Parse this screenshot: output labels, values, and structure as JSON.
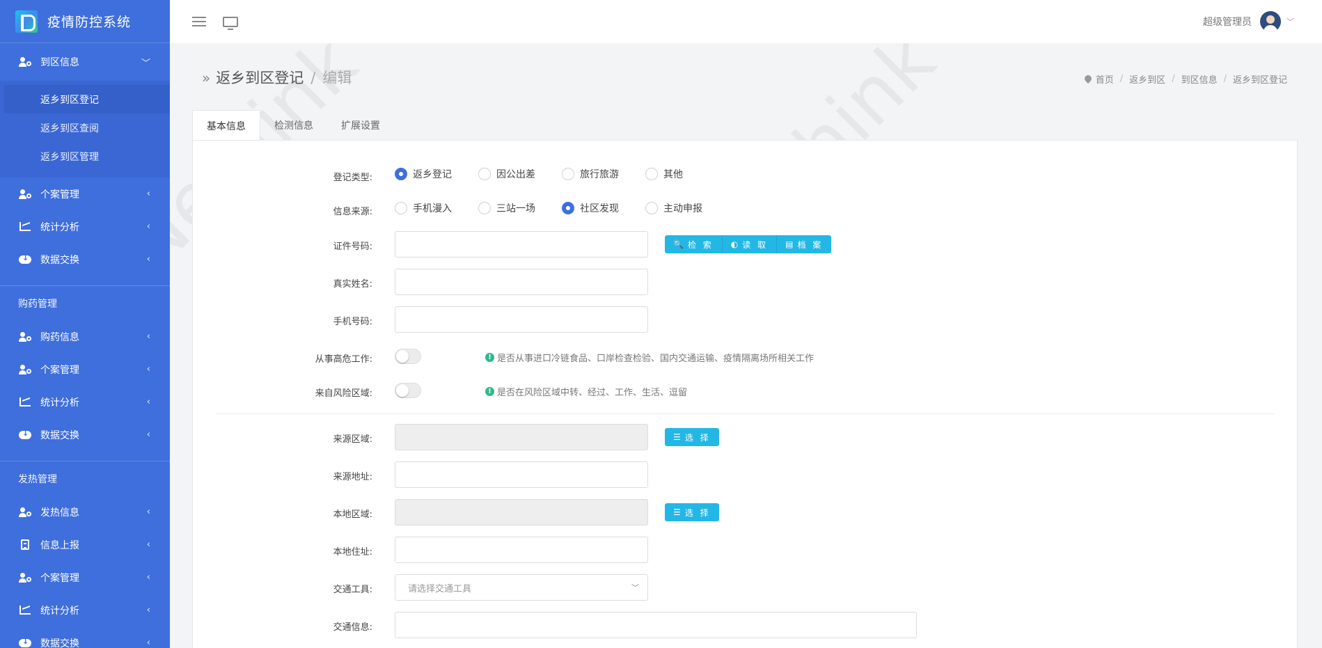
{
  "app": {
    "title": "疫情防控系统"
  },
  "topbar": {
    "admin_name": "超级管理员"
  },
  "sidebar": {
    "group1": {
      "open_item": "到区信息",
      "sub_items": [
        "返乡到区登记",
        "返乡到区查阅",
        "返乡到区管理"
      ],
      "items": [
        "个案管理",
        "统计分析",
        "数据交换"
      ]
    },
    "group2": {
      "title": "购药管理",
      "items": [
        "购药信息",
        "个案管理",
        "统计分析",
        "数据交换"
      ]
    },
    "group3": {
      "title": "发热管理",
      "items": [
        "发热信息",
        "信息上报",
        "个案管理",
        "统计分析",
        "数据交换"
      ]
    }
  },
  "page": {
    "title": "返乡到区登记",
    "subtitle": "编辑"
  },
  "breadcrumb": [
    "首页",
    "返乡到区",
    "到区信息",
    "返乡到区登记"
  ],
  "tabs": [
    "基本信息",
    "检测信息",
    "扩展设置"
  ],
  "form": {
    "reg_type": {
      "label": "登记类型:",
      "options": [
        "返乡登记",
        "因公出差",
        "旅行旅游",
        "其他"
      ],
      "selected": "返乡登记"
    },
    "info_source": {
      "label": "信息来源:",
      "options": [
        "手机漫入",
        "三站一场",
        "社区发现",
        "主动申报"
      ],
      "selected": "社区发现"
    },
    "id_number": {
      "label": "证件号码:",
      "value": ""
    },
    "id_buttons": {
      "search": "检 索",
      "read": "读 取",
      "archive": "档 案"
    },
    "real_name": {
      "label": "真实姓名:",
      "value": ""
    },
    "phone": {
      "label": "手机号码:",
      "value": ""
    },
    "high_risk_work": {
      "label": "从事高危工作:",
      "hint": "是否从事进口冷链食品、口岸检查检验、国内交通运输、疫情隔离场所相关工作",
      "on": false
    },
    "risk_area": {
      "label": "来自风险区域:",
      "hint": "是否在风险区域中转、经过、工作、生活、逗留",
      "on": false
    },
    "source_region": {
      "label": "来源区域:",
      "value": "",
      "button": "选 择"
    },
    "source_address": {
      "label": "来源地址:",
      "value": ""
    },
    "local_region": {
      "label": "本地区域:",
      "value": "",
      "button": "选 择"
    },
    "local_address": {
      "label": "本地住址:",
      "value": ""
    },
    "transport": {
      "label": "交通工具:",
      "placeholder": "请选择交通工具"
    },
    "transport_info": {
      "label": "交通信息:",
      "value": ""
    }
  },
  "watermark": "iNethink",
  "colors": {
    "sidebar": "#3f6fdc",
    "accent": "#23b7e5",
    "radio_checked": "#3f6fdc"
  }
}
